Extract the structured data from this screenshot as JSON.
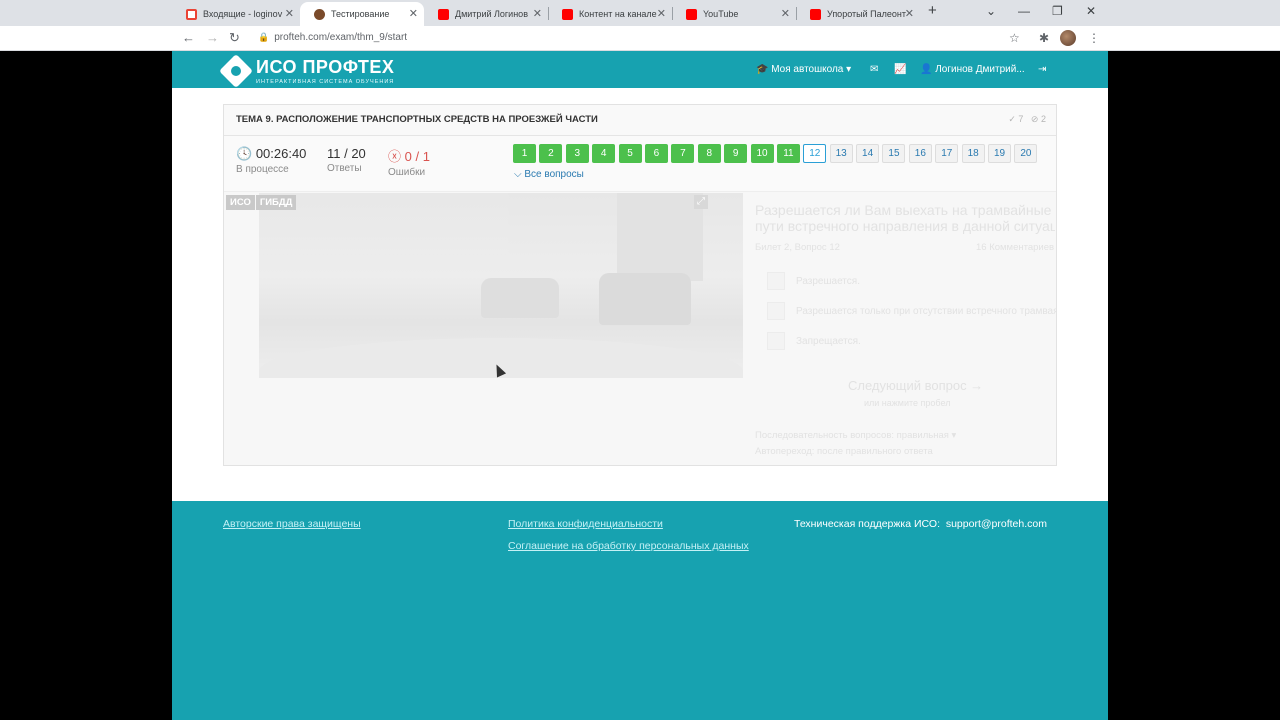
{
  "browser": {
    "tabs": [
      {
        "label": "Входящие - loginov",
        "icon": "gmail-icon",
        "color": "#ea4335",
        "active": false
      },
      {
        "label": "Тестирование",
        "icon": "profteh-icon",
        "color": "#7a4a2a",
        "active": true
      },
      {
        "label": "Дмитрий Логинов",
        "icon": "youtube-icon",
        "color": "#ff0000",
        "active": false
      },
      {
        "label": "Контент на канале",
        "icon": "youtube-icon",
        "color": "#ff0000",
        "active": false
      },
      {
        "label": "YouTube",
        "icon": "youtube-icon",
        "color": "#ff0000",
        "active": false
      },
      {
        "label": "Упоротый Палеонт",
        "icon": "youtube-icon",
        "color": "#ff0000",
        "active": false
      }
    ],
    "new_tab": "+",
    "url": "profteh.com/exam/thm_9/start"
  },
  "header": {
    "logo_title": "ИСО ПРОФТЕХ",
    "logo_subtitle": "ИНТЕРАКТИВНАЯ СИСТЕМА ОБУЧЕНИЯ",
    "school_menu": "Моя автошкола",
    "user_name": "Логинов Дмитрий..."
  },
  "exam": {
    "topic_title": "ТЕМА 9. РАСПОЛОЖЕНИЕ ТРАНСПОРТНЫХ СРЕДСТВ НА ПРОЕЗЖЕЙ ЧАСТИ",
    "stat_correct": "7",
    "stat_wrong": "2",
    "timer": "00:26:40",
    "timer_label": "В процессе",
    "answers": "11 / 20",
    "answers_label": "Ответы",
    "errors": "0 / 1",
    "errors_label": "Ошибки",
    "questions": [
      {
        "n": "1",
        "state": "ok"
      },
      {
        "n": "2",
        "state": "ok"
      },
      {
        "n": "3",
        "state": "ok"
      },
      {
        "n": "4",
        "state": "ok"
      },
      {
        "n": "5",
        "state": "ok"
      },
      {
        "n": "6",
        "state": "ok"
      },
      {
        "n": "7",
        "state": "ok"
      },
      {
        "n": "8",
        "state": "ok"
      },
      {
        "n": "9",
        "state": "ok"
      },
      {
        "n": "10",
        "state": "ok"
      },
      {
        "n": "11",
        "state": "ok"
      },
      {
        "n": "12",
        "state": "cur"
      },
      {
        "n": "13",
        "state": "todo"
      },
      {
        "n": "14",
        "state": "todo"
      },
      {
        "n": "15",
        "state": "todo"
      },
      {
        "n": "16",
        "state": "todo"
      },
      {
        "n": "17",
        "state": "todo"
      },
      {
        "n": "18",
        "state": "todo"
      },
      {
        "n": "19",
        "state": "todo"
      },
      {
        "n": "20",
        "state": "todo"
      }
    ],
    "all_questions": "Все вопросы",
    "badge_iso": "ИСО",
    "badge_gibdd": "ГИБДД",
    "question_text_1": "Разрешается ли Вам выехать на трамвайные",
    "question_text_2": "пути встречного направления в данной ситуац",
    "question_meta_left": "Билет 2, Вопрос 12",
    "question_meta_right": "16 Комментариев",
    "options": [
      "Разрешается.",
      "Разрешается только при отсутствии встречного трамвая.",
      "Запрещается."
    ],
    "next_button": "Следующий вопрос →",
    "next_hint": "или нажмите пробел",
    "ghost_line_1": "Последовательность вопросов: правильная ▾",
    "ghost_line_2": "Автопереход: после правильного ответа"
  },
  "footer": {
    "copyright": "Авторские права защищены",
    "privacy": "Политика конфиденциальности",
    "agreement": "Соглашение на обработку персональных данных",
    "support_label": "Техническая поддержка ИСО:",
    "support_email": "support@profteh.com"
  }
}
